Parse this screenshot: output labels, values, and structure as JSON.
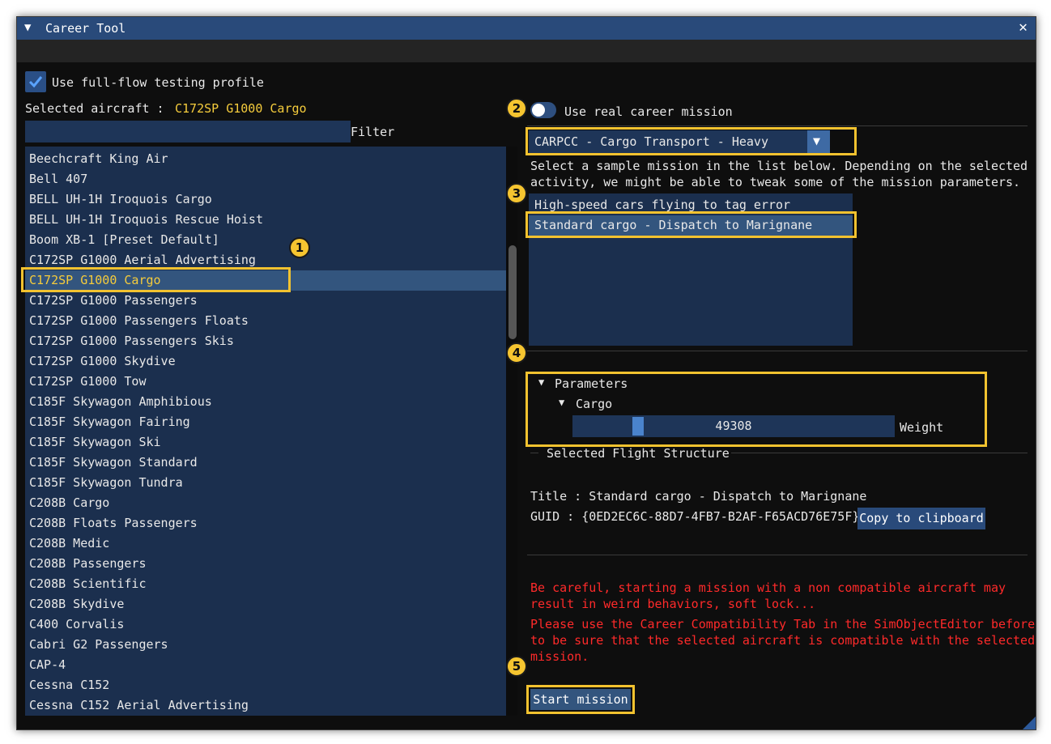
{
  "window": {
    "title": "Career Tool",
    "collapse_glyph": "▼",
    "close_glyph": "✕"
  },
  "profile": {
    "checkbox_label": "Use full-flow testing profile",
    "checked": true
  },
  "selected_aircraft": {
    "label": "Selected aircraft :",
    "value": "C172SP G1000 Cargo"
  },
  "filter": {
    "label": "Filter",
    "value": ""
  },
  "aircraft_list": {
    "selected_index": 6,
    "items": [
      "Beechcraft King Air",
      "Bell 407",
      "BELL UH-1H Iroquois Cargo",
      "BELL UH-1H Iroquois Rescue Hoist",
      "Boom XB-1 [Preset Default]",
      "C172SP G1000 Aerial Advertising",
      "C172SP G1000 Cargo",
      "C172SP G1000 Passengers",
      "C172SP G1000 Passengers Floats",
      "C172SP G1000 Passengers Skis",
      "C172SP G1000 Skydive",
      "C172SP G1000 Tow",
      "C185F Skywagon Amphibious",
      "C185F Skywagon Fairing",
      "C185F Skywagon Ski",
      "C185F Skywagon Standard",
      "C185F Skywagon Tundra",
      "C208B Cargo",
      "C208B Floats Passengers",
      "C208B Medic",
      "C208B Passengers",
      "C208B Scientific",
      "C208B Skydive",
      "C400 Corvalis",
      "Cabri G2 Passengers",
      "CAP-4",
      "Cessna C152",
      "Cessna C152 Aerial Advertising"
    ]
  },
  "career_toggle": {
    "label": "Use real career mission",
    "on": false
  },
  "activity_combo": {
    "value": "CARPCC - Cargo Transport - Heavy",
    "arrow_glyph": "▼"
  },
  "instructions": {
    "line1": "Select a sample mission in the list below. Depending on the selected",
    "line2": "activity, we might be able to tweak some of the mission parameters."
  },
  "mission_list": {
    "selected_index": 1,
    "items": [
      "High-speed cars flying to tag_error",
      "Standard cargo - Dispatch to Marignane"
    ]
  },
  "parameters": {
    "header": "Parameters",
    "subheader": "Cargo",
    "tree_glyph": "▼",
    "weight_label": "Weight",
    "weight_value": "49308"
  },
  "flight_structure": {
    "section_title": "Selected Flight Structure",
    "title_line": "Title : Standard cargo - Dispatch to Marignane",
    "guid_line": "GUID : {0ED2EC6C-88D7-4FB7-B2AF-F65ACD76E75F}",
    "copy_button": "Copy to clipboard"
  },
  "warnings": {
    "line1": "Be careful, starting a mission with a non compatible aircraft may",
    "line2": "result in weird behaviors, soft lock...",
    "line3": "Please use the Career Compatibility Tab in the SimObjectEditor before",
    "line4": "to be sure that the selected aircraft is compatible with the selected",
    "line5": "mission."
  },
  "start_button": "Start mission",
  "badges": [
    "1",
    "2",
    "3",
    "4",
    "5"
  ],
  "colors": {
    "accent_yellow": "#f2c22f",
    "title_bar": "#294a7a",
    "list_bg": "#1b2f4e",
    "selected_row": "#33557e",
    "warning_red": "#ff2a2a"
  }
}
